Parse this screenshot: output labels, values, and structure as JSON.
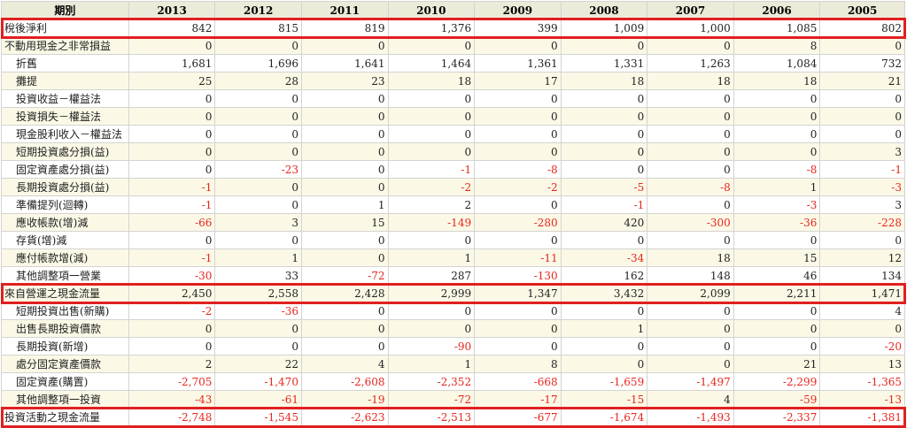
{
  "table": {
    "headers": [
      "期別",
      "2013",
      "2012",
      "2011",
      "2010",
      "2009",
      "2008",
      "2007",
      "2006",
      "2005"
    ],
    "rows": [
      {
        "label": "稅後淨利",
        "indent": false,
        "highlight": true,
        "values": [
          "842",
          "815",
          "819",
          "1,376",
          "399",
          "1,009",
          "1,000",
          "1,085",
          "802"
        ]
      },
      {
        "label": "不動用現金之非常損益",
        "indent": false,
        "highlight": false,
        "values": [
          "0",
          "0",
          "0",
          "0",
          "0",
          "0",
          "0",
          "8",
          "0"
        ]
      },
      {
        "label": "折舊",
        "indent": true,
        "highlight": false,
        "values": [
          "1,681",
          "1,696",
          "1,641",
          "1,464",
          "1,361",
          "1,331",
          "1,263",
          "1,084",
          "732"
        ]
      },
      {
        "label": "攤提",
        "indent": true,
        "highlight": false,
        "values": [
          "25",
          "28",
          "23",
          "18",
          "17",
          "18",
          "18",
          "18",
          "21"
        ]
      },
      {
        "label": "投資收益－權益法",
        "indent": true,
        "highlight": false,
        "values": [
          "0",
          "0",
          "0",
          "0",
          "0",
          "0",
          "0",
          "0",
          "0"
        ]
      },
      {
        "label": "投資損失－權益法",
        "indent": true,
        "highlight": false,
        "values": [
          "0",
          "0",
          "0",
          "0",
          "0",
          "0",
          "0",
          "0",
          "0"
        ]
      },
      {
        "label": "現金股利收入－權益法",
        "indent": true,
        "highlight": false,
        "values": [
          "0",
          "0",
          "0",
          "0",
          "0",
          "0",
          "0",
          "0",
          "0"
        ]
      },
      {
        "label": "短期投資處分損(益)",
        "indent": true,
        "highlight": false,
        "values": [
          "0",
          "0",
          "0",
          "0",
          "0",
          "0",
          "0",
          "0",
          "3"
        ]
      },
      {
        "label": "固定資產處分損(益)",
        "indent": true,
        "highlight": false,
        "values": [
          "0",
          "-23",
          "0",
          "-1",
          "-8",
          "0",
          "0",
          "-8",
          "-1"
        ]
      },
      {
        "label": "長期投資處分損(益)",
        "indent": true,
        "highlight": false,
        "values": [
          "-1",
          "0",
          "0",
          "-2",
          "-2",
          "-5",
          "-8",
          "1",
          "-3"
        ]
      },
      {
        "label": "準備提列(迴轉)",
        "indent": true,
        "highlight": false,
        "values": [
          "-1",
          "0",
          "1",
          "2",
          "0",
          "-1",
          "0",
          "-3",
          "3"
        ]
      },
      {
        "label": "應收帳款(增)減",
        "indent": true,
        "highlight": false,
        "values": [
          "-66",
          "3",
          "15",
          "-149",
          "-280",
          "420",
          "-300",
          "-36",
          "-228"
        ]
      },
      {
        "label": "存貨(增)減",
        "indent": true,
        "highlight": false,
        "values": [
          "0",
          "0",
          "0",
          "0",
          "0",
          "0",
          "0",
          "0",
          "0"
        ]
      },
      {
        "label": "應付帳款增(減)",
        "indent": true,
        "highlight": false,
        "values": [
          "-1",
          "1",
          "0",
          "1",
          "-11",
          "-34",
          "18",
          "15",
          "12"
        ]
      },
      {
        "label": "其他調整項一營業",
        "indent": true,
        "highlight": false,
        "values": [
          "-30",
          "33",
          "-72",
          "287",
          "-130",
          "162",
          "148",
          "46",
          "134"
        ]
      },
      {
        "label": "來自營運之現金流量",
        "indent": false,
        "highlight": true,
        "values": [
          "2,450",
          "2,558",
          "2,428",
          "2,999",
          "1,347",
          "3,432",
          "2,099",
          "2,211",
          "1,471"
        ]
      },
      {
        "label": "短期投資出售(新購)",
        "indent": true,
        "highlight": false,
        "values": [
          "-2",
          "-36",
          "0",
          "0",
          "0",
          "0",
          "0",
          "0",
          "4"
        ]
      },
      {
        "label": "出售長期投資價款",
        "indent": true,
        "highlight": false,
        "values": [
          "0",
          "0",
          "0",
          "0",
          "0",
          "1",
          "0",
          "0",
          "0"
        ]
      },
      {
        "label": "長期投資(新增)",
        "indent": true,
        "highlight": false,
        "values": [
          "0",
          "0",
          "0",
          "-90",
          "0",
          "0",
          "0",
          "0",
          "-20"
        ]
      },
      {
        "label": "處分固定資產價款",
        "indent": true,
        "highlight": false,
        "values": [
          "2",
          "22",
          "4",
          "1",
          "8",
          "0",
          "0",
          "21",
          "13"
        ]
      },
      {
        "label": "固定資產(購置)",
        "indent": true,
        "highlight": false,
        "values": [
          "-2,705",
          "-1,470",
          "-2,608",
          "-2,352",
          "-668",
          "-1,659",
          "-1,497",
          "-2,299",
          "-1,365"
        ]
      },
      {
        "label": "其他調整項一投資",
        "indent": true,
        "highlight": false,
        "values": [
          "-43",
          "-61",
          "-19",
          "-72",
          "-17",
          "-15",
          "4",
          "-59",
          "-13"
        ]
      },
      {
        "label": "投資活動之現金流量",
        "indent": false,
        "highlight": true,
        "values": [
          "-2,748",
          "-1,545",
          "-2,623",
          "-2,513",
          "-677",
          "-1,674",
          "-1,493",
          "-2,337",
          "-1,381"
        ]
      }
    ]
  },
  "colors": {
    "header_bg": "#ecebd9",
    "stripe_bg": "#fbf9e6",
    "negative": "#e8261e",
    "highlight_border": "#e02020"
  }
}
